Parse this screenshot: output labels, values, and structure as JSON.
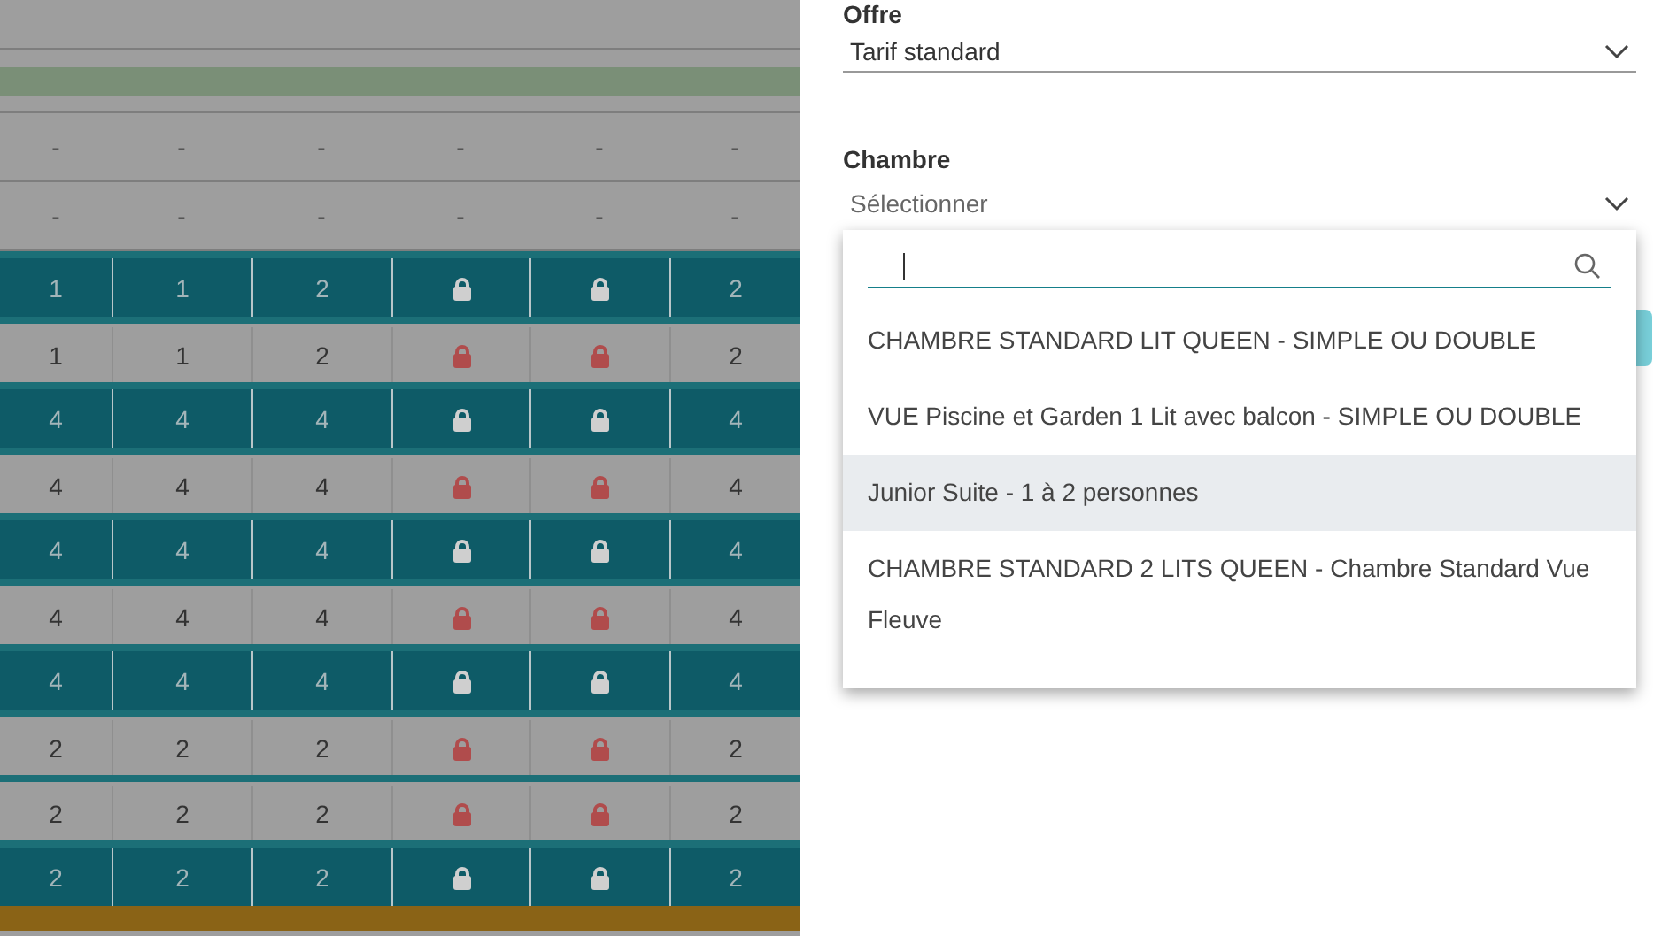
{
  "table": {
    "rows": [
      {
        "kind": "blank"
      },
      {
        "kind": "band",
        "color": "#7a8f77"
      },
      {
        "kind": "plain",
        "cells": [
          {
            "kind": "text",
            "text": "-"
          },
          {
            "kind": "text",
            "text": "-"
          },
          {
            "kind": "text",
            "text": "-"
          },
          {
            "kind": "text",
            "text": "-"
          },
          {
            "kind": "text",
            "text": "-"
          },
          {
            "kind": "text",
            "text": "-"
          }
        ]
      },
      {
        "kind": "plain",
        "cells": [
          {
            "kind": "text",
            "text": "-"
          },
          {
            "kind": "text",
            "text": "-"
          },
          {
            "kind": "text",
            "text": "-"
          },
          {
            "kind": "text",
            "text": "-"
          },
          {
            "kind": "text",
            "text": "-"
          },
          {
            "kind": "text",
            "text": "-"
          }
        ]
      },
      {
        "kind": "open",
        "cells": [
          {
            "kind": "text",
            "text": "1"
          },
          {
            "kind": "text",
            "text": "1"
          },
          {
            "kind": "text",
            "text": "2"
          },
          {
            "kind": "lock"
          },
          {
            "kind": "lock"
          },
          {
            "kind": "text",
            "text": "2"
          }
        ]
      },
      {
        "kind": "closed",
        "cells": [
          {
            "kind": "text",
            "text": "1"
          },
          {
            "kind": "text",
            "text": "1"
          },
          {
            "kind": "text",
            "text": "2"
          },
          {
            "kind": "lock"
          },
          {
            "kind": "lock"
          },
          {
            "kind": "text",
            "text": "2"
          }
        ]
      },
      {
        "kind": "open",
        "cells": [
          {
            "kind": "text",
            "text": "4"
          },
          {
            "kind": "text",
            "text": "4"
          },
          {
            "kind": "text",
            "text": "4"
          },
          {
            "kind": "lock"
          },
          {
            "kind": "lock"
          },
          {
            "kind": "text",
            "text": "4"
          }
        ]
      },
      {
        "kind": "closed",
        "cells": [
          {
            "kind": "text",
            "text": "4"
          },
          {
            "kind": "text",
            "text": "4"
          },
          {
            "kind": "text",
            "text": "4"
          },
          {
            "kind": "lock"
          },
          {
            "kind": "lock"
          },
          {
            "kind": "text",
            "text": "4"
          }
        ]
      },
      {
        "kind": "open",
        "cells": [
          {
            "kind": "text",
            "text": "4"
          },
          {
            "kind": "text",
            "text": "4"
          },
          {
            "kind": "text",
            "text": "4"
          },
          {
            "kind": "lock"
          },
          {
            "kind": "lock"
          },
          {
            "kind": "text",
            "text": "4"
          }
        ]
      },
      {
        "kind": "closed",
        "cells": [
          {
            "kind": "text",
            "text": "4"
          },
          {
            "kind": "text",
            "text": "4"
          },
          {
            "kind": "text",
            "text": "4"
          },
          {
            "kind": "lock"
          },
          {
            "kind": "lock"
          },
          {
            "kind": "text",
            "text": "4"
          }
        ]
      },
      {
        "kind": "open",
        "cells": [
          {
            "kind": "text",
            "text": "4"
          },
          {
            "kind": "text",
            "text": "4"
          },
          {
            "kind": "text",
            "text": "4"
          },
          {
            "kind": "lock"
          },
          {
            "kind": "lock"
          },
          {
            "kind": "text",
            "text": "4"
          }
        ]
      },
      {
        "kind": "closed",
        "cells": [
          {
            "kind": "text",
            "text": "2"
          },
          {
            "kind": "text",
            "text": "2"
          },
          {
            "kind": "text",
            "text": "2"
          },
          {
            "kind": "lock"
          },
          {
            "kind": "lock"
          },
          {
            "kind": "text",
            "text": "2"
          }
        ]
      },
      {
        "kind": "closed",
        "cells": [
          {
            "kind": "text",
            "text": "2"
          },
          {
            "kind": "text",
            "text": "2"
          },
          {
            "kind": "text",
            "text": "2"
          },
          {
            "kind": "lock"
          },
          {
            "kind": "lock"
          },
          {
            "kind": "text",
            "text": "2"
          }
        ]
      },
      {
        "kind": "open",
        "cells": [
          {
            "kind": "text",
            "text": "2"
          },
          {
            "kind": "text",
            "text": "2"
          },
          {
            "kind": "text",
            "text": "2"
          },
          {
            "kind": "lock"
          },
          {
            "kind": "lock"
          },
          {
            "kind": "text",
            "text": "2"
          }
        ]
      },
      {
        "kind": "band",
        "color": "#8a6316"
      }
    ]
  },
  "form": {
    "offer": {
      "label": "Offre",
      "value": "Tarif standard"
    },
    "room": {
      "label": "Chambre",
      "placeholder": "Sélectionner",
      "expanded": true,
      "options": [
        {
          "label": "CHAMBRE STANDARD LIT QUEEN - SIMPLE OU DOUBLE",
          "selected": false
        },
        {
          "label": "VUE Piscine et Garden 1 Lit avec balcon - SIMPLE OU DOUBLE",
          "selected": false
        },
        {
          "label": "Junior Suite - 1 à 2 personnes",
          "selected": true
        },
        {
          "label": "CHAMBRE STANDARD 2 LITS QUEEN - Chambre Standard Vue Fleuve",
          "selected": false
        }
      ]
    }
  }
}
